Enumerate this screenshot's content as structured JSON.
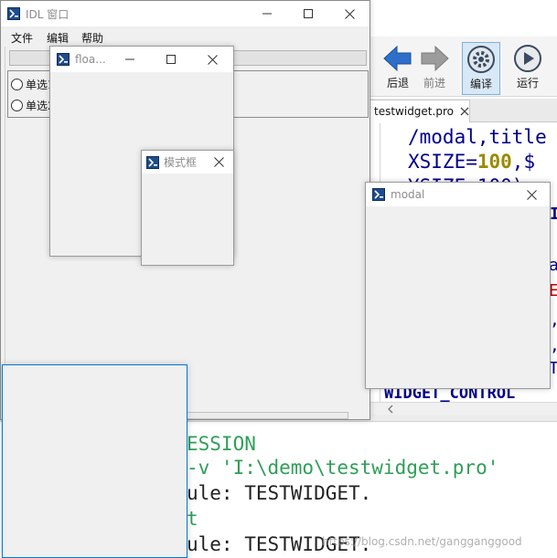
{
  "ide": {
    "toolbar": {
      "back_label": "后退",
      "forward_label": "前进",
      "compile_label": "编译",
      "run_label": "运行"
    },
    "tab": {
      "name": "testwidget.pro"
    },
    "editor_lines": [
      {
        "text": "/modal,title",
        "color": "#00008b"
      },
      {
        "prefix": "XSIZE=",
        "value": "100",
        "suffix": ",$",
        "color": "#00008b",
        "value_color": "#9a8a00"
      },
      {
        "text": "YSIZE=100)",
        "color": "#00008b"
      },
      {
        "text": "WIDGET_CONTROL",
        "color": "#00008b"
      }
    ],
    "console_lines": [
      {
        "text": "ESSION",
        "color": "#2e9f57"
      },
      {
        "text": "-v 'I:\\demo\\testwidget.pro'",
        "color": "#2e9f57"
      },
      {
        "text": "ule: TESTWIDGET.",
        "color": "#222222"
      },
      {
        "text": "t",
        "color": "#2e9f57"
      },
      {
        "text": "ule: TESTWIDGET.",
        "color": "#222222"
      }
    ],
    "watermark": "https://blog.csdn.net/gangganggood"
  },
  "main_window": {
    "title": "IDL 窗口",
    "menu": [
      "文件",
      "编辑",
      "帮助"
    ],
    "radio_labels": [
      "单选1",
      "单选2"
    ]
  },
  "float_window": {
    "title": "floa..."
  },
  "modal_frame_window": {
    "title": "模式框"
  },
  "modal_window": {
    "title": "modal"
  },
  "colors": {
    "accent_blue": "#0078d7",
    "keyword_navy": "#00008b",
    "console_green": "#2e9f57",
    "string_green": "#00a63c"
  }
}
